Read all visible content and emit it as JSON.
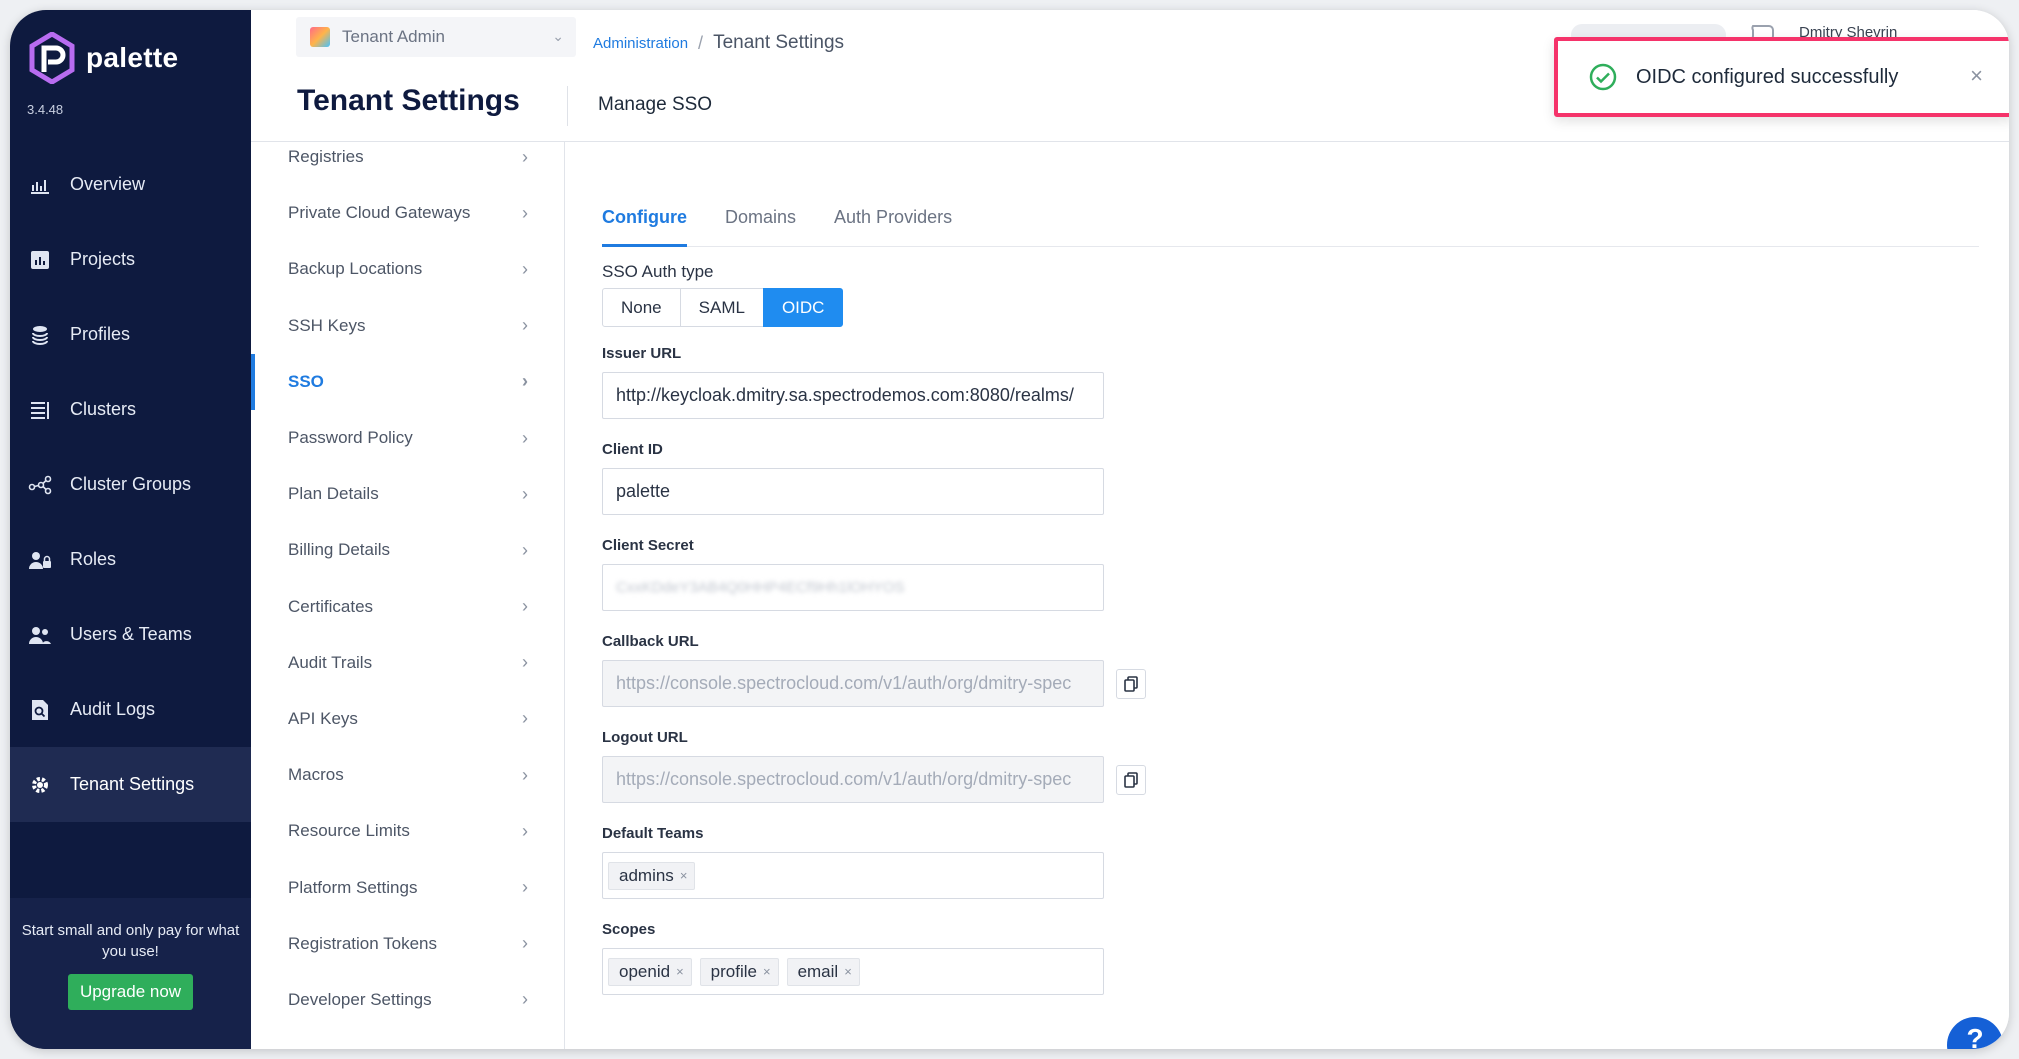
{
  "app": {
    "brand": "palette",
    "version": "3.4.48"
  },
  "nav": {
    "items": [
      {
        "label": "Overview",
        "icon": "chart-icon"
      },
      {
        "label": "Projects",
        "icon": "bar-chart-icon"
      },
      {
        "label": "Profiles",
        "icon": "stack-icon"
      },
      {
        "label": "Clusters",
        "icon": "list-icon"
      },
      {
        "label": "Cluster Groups",
        "icon": "network-icon"
      },
      {
        "label": "Roles",
        "icon": "user-lock-icon"
      },
      {
        "label": "Users & Teams",
        "icon": "users-icon"
      },
      {
        "label": "Audit Logs",
        "icon": "document-search-icon"
      },
      {
        "label": "Tenant Settings",
        "icon": "gear-icon"
      }
    ],
    "active": "Tenant Settings",
    "promo_text": "Start small and only pay for what you use!",
    "upgrade_label": "Upgrade now"
  },
  "topbar": {
    "scope_label": "Tenant Admin",
    "breadcrumb_parent": "Administration",
    "breadcrumb_separator": "/",
    "breadcrumb_current": "Tenant Settings",
    "page_title": "Tenant Settings",
    "subtitle": "Manage SSO",
    "user_name": "Dmitry Shevrin"
  },
  "toast": {
    "message": "OIDC configured successfully",
    "close": "×"
  },
  "submenu": {
    "items": [
      "Registries",
      "Private Cloud Gateways",
      "Backup Locations",
      "SSH Keys",
      "SSO",
      "Password Policy",
      "Plan Details",
      "Billing Details",
      "Certificates",
      "Audit Trails",
      "API Keys",
      "Macros",
      "Resource Limits",
      "Platform Settings",
      "Registration Tokens",
      "Developer Settings"
    ],
    "active": "SSO",
    "arrow": "›"
  },
  "tabs": [
    "Configure",
    "Domains",
    "Auth Providers"
  ],
  "form": {
    "auth_type_label": "SSO Auth type",
    "auth_types": [
      "None",
      "SAML",
      "OIDC"
    ],
    "auth_type_selected": "OIDC",
    "issuer_label": "Issuer URL",
    "issuer_value": "http://keycloak.dmitry.sa.spectrodemos.com:8080/realms/",
    "client_id_label": "Client ID",
    "client_id_value": "palette",
    "client_secret_label": "Client Secret",
    "client_secret_value": "CxxKDdeY3AB4Q0HHP4ECf9Hh1lOHYOS",
    "callback_label": "Callback URL",
    "callback_value": "https://console.spectrocloud.com/v1/auth/org/dmitry-spec",
    "logout_label": "Logout URL",
    "logout_value": "https://console.spectrocloud.com/v1/auth/org/dmitry-spec",
    "default_teams_label": "Default Teams",
    "default_teams": [
      "admins"
    ],
    "scopes_label": "Scopes",
    "scopes": [
      "openid",
      "profile",
      "email"
    ],
    "tag_remove": "×"
  },
  "help": {
    "label": "?"
  },
  "colors": {
    "nav_bg": "#0e1a3f",
    "accent": "#1f7be0",
    "oidc_active": "#1f8cf0",
    "upgrade": "#2fae5b",
    "highlight": "#f5336a",
    "success": "#2fae5b"
  }
}
